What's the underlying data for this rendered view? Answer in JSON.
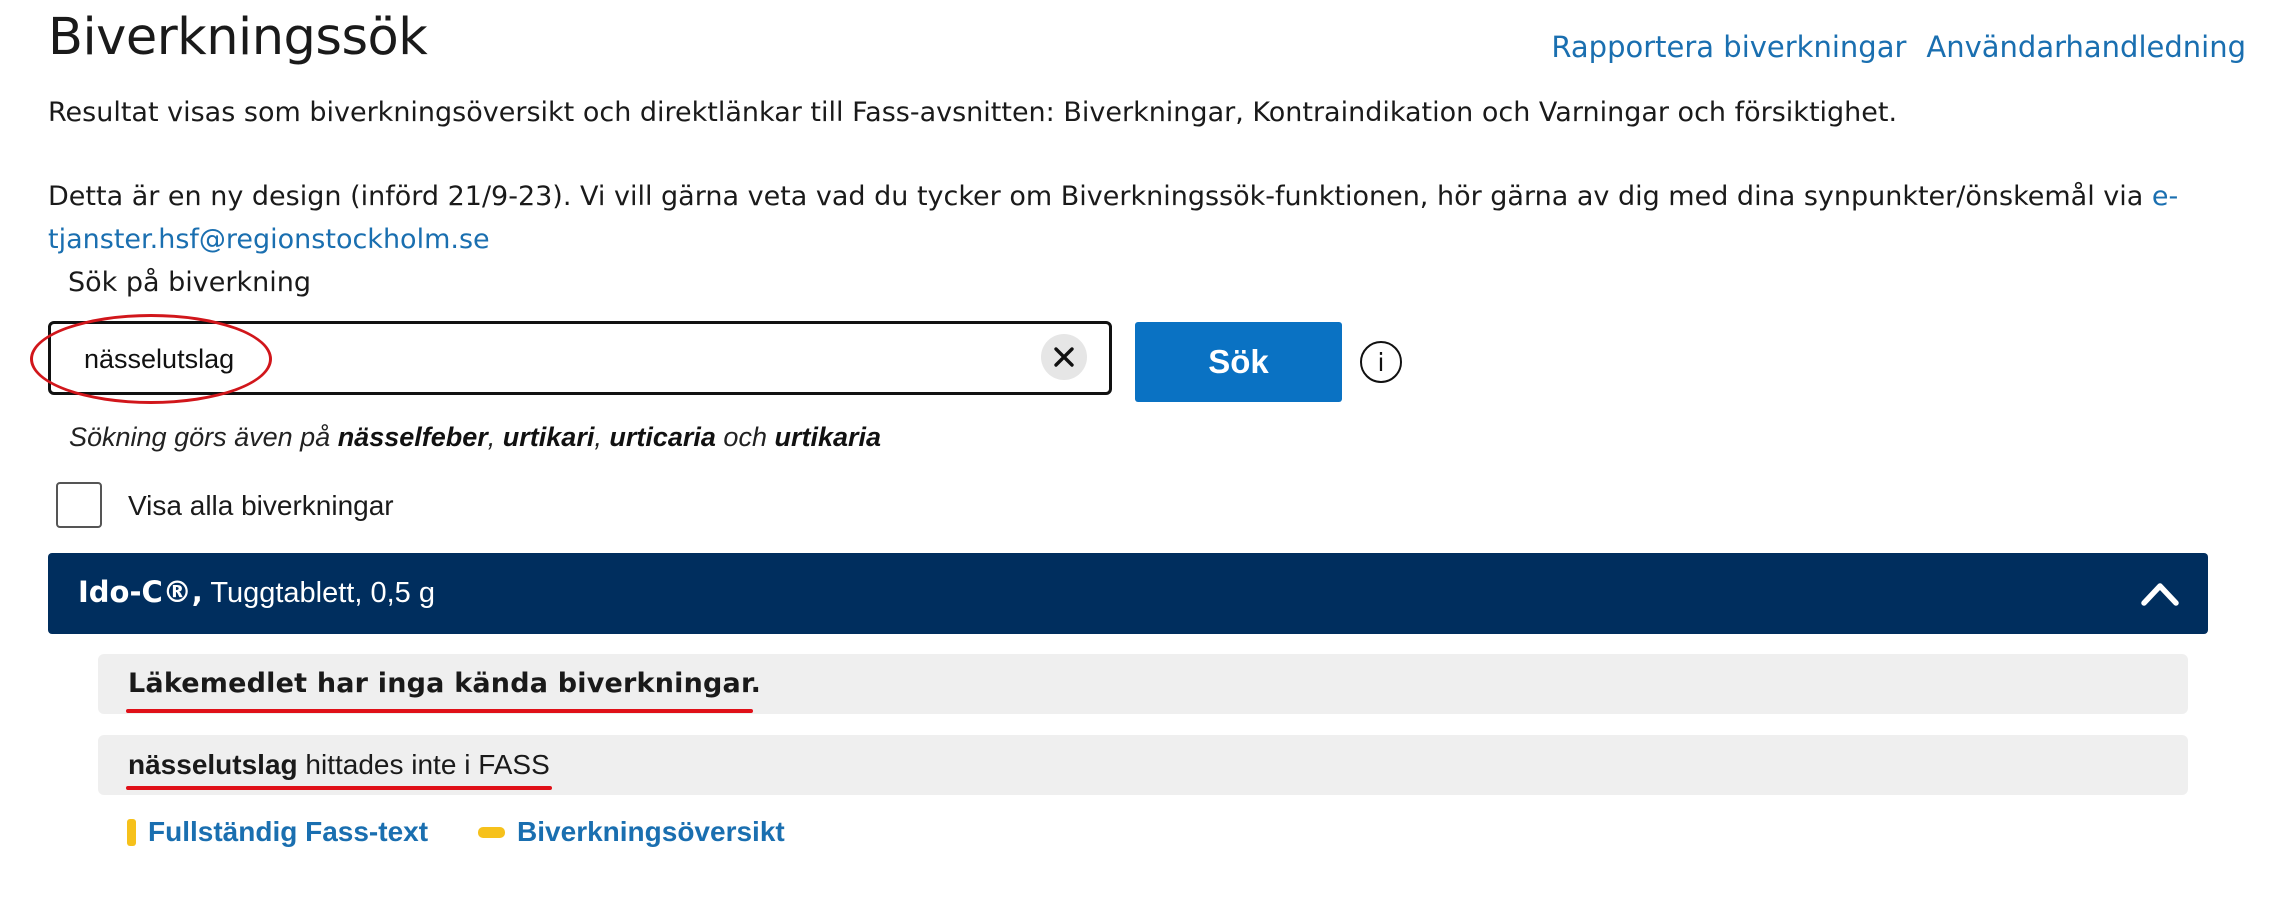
{
  "header": {
    "title": "Biverkningssök",
    "links": [
      "Rapportera biverkningar",
      "Användarhandledning"
    ]
  },
  "intro": {
    "line1": "Resultat visas som biverkningsöversikt och direktlänkar till Fass-avsnitten: Biverkningar, Kontraindikation och Varningar och försiktighet.",
    "line2_text": "Detta är en ny design (införd 21/9-23).  Vi vill gärna veta vad du tycker om Biverkningssök-funktionen, hör gärna av dig med dina synpunkter/önskemål via ",
    "email": "e-tjanster.hsf@regionstockholm.se"
  },
  "search": {
    "label": "Sök på biverkning",
    "value": "nässelutslag",
    "button_label": "Sök",
    "info_label": "i",
    "hint_prefix": "Sökning görs även på ",
    "hint_terms": [
      "nässelfeber",
      "urtikari",
      "urticaria",
      "urtikaria"
    ],
    "hint_sep1": ", ",
    "hint_sep2": ", ",
    "hint_and": " och "
  },
  "show_all": {
    "label": "Visa alla biverkningar",
    "checked": false
  },
  "result": {
    "product_brand": "Ido-C®,",
    "product_detail": " Tuggtablett, 0,5 g",
    "expanded": true,
    "message_no_effects": "Läkemedlet har inga kända biverkningar.",
    "not_found_term": "nässelutslag",
    "not_found_suffix": " hittades inte i FASS",
    "links": [
      "Fullständig Fass-text",
      "Biverkningsöversikt"
    ]
  },
  "colors": {
    "link": "#1a6fb0",
    "primary_button": "#0a72c3",
    "product_bar": "#002e5e",
    "annotation_red": "#d1161b",
    "link_marker": "#f6c11b"
  }
}
